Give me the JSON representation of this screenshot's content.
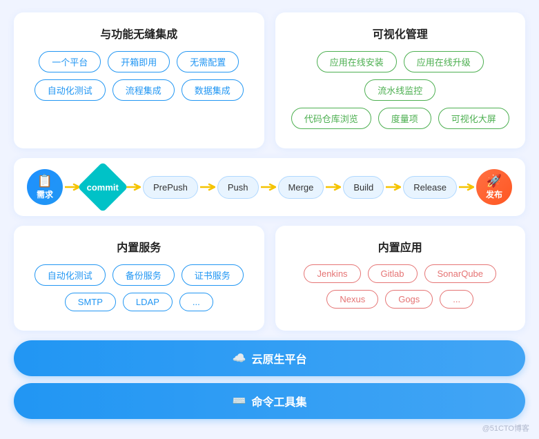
{
  "topLeft": {
    "title": "与功能无缝集成",
    "tags1": [
      "一个平台",
      "开箱即用",
      "无需配置"
    ],
    "tags2": [
      "自动化测试",
      "流程集成",
      "数据集成"
    ]
  },
  "topRight": {
    "title": "可视化管理",
    "tags1": [
      "应用在线安装",
      "应用在线升级",
      "流水线监控"
    ],
    "tags2": [
      "代码仓库浏览",
      "度量项",
      "可视化大屏"
    ]
  },
  "pipeline": {
    "steps": [
      "需求",
      "commit",
      "PrePush",
      "Push",
      "Merge",
      "Build",
      "Release",
      "发布"
    ]
  },
  "bottomLeft": {
    "title": "内置服务",
    "tags1": [
      "自动化测试",
      "备份服务",
      "证书服务"
    ],
    "tags2": [
      "SMTP",
      "LDAP",
      "..."
    ]
  },
  "bottomRight": {
    "title": "内置应用",
    "tags1": [
      "Jenkins",
      "Gitlab",
      "SonarQube"
    ],
    "tags2": [
      "Nexus",
      "Gogs",
      "..."
    ]
  },
  "buttons": {
    "cloud": "云原生平台",
    "cli": "命令工具集"
  },
  "watermark": "@51CTO博客"
}
